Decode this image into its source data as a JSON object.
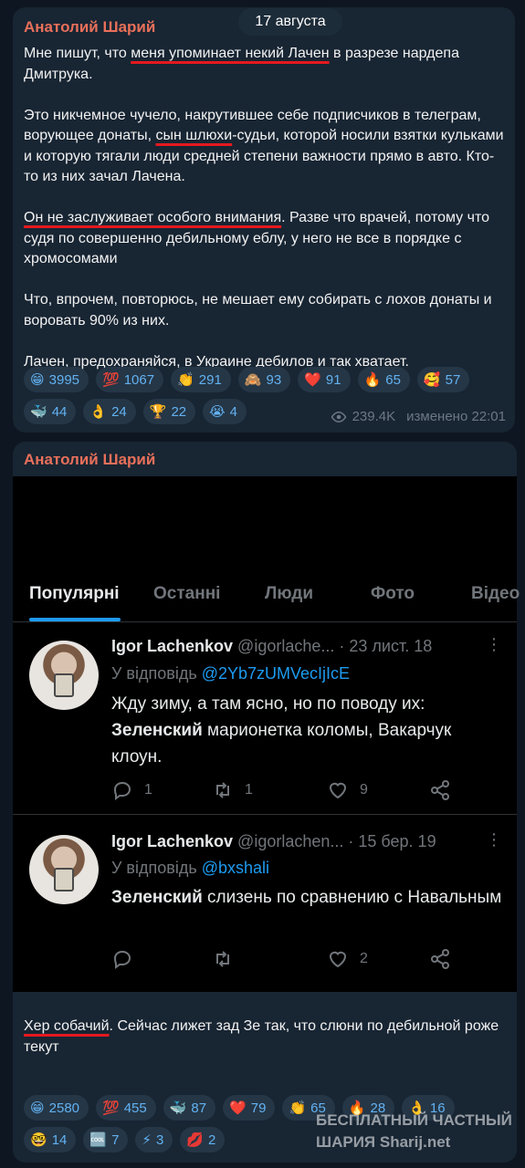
{
  "date_separator": "17 августа",
  "message1": {
    "author": "Анатолий Шарий",
    "paragraphs": [
      [
        "Мне пишут, что ",
        "меня упоминает некий Лачен",
        " в разрезе нардепа Дмитрука."
      ],
      [
        "Это никчемное чучело, накрутившее себе подписчиков в телеграм, ворующее донаты, ",
        "сын шлюхи",
        "-судьи, которой носили взятки кульками и которую тягали люди средней степени важности прямо в авто. Кто-то из них зачал Лачена."
      ],
      [
        "",
        "Он не заслуживает особого внимания",
        ". Разве что врачей, потому что судя по совершенно дебильному еблу, у него не все в порядке с хромосомами"
      ],
      [
        "Что, впрочем, повторюсь, не мешает ему собирать с лохов донаты и воровать 90% из них."
      ],
      [
        "Лачен, предохраняйся, в Украине дебилов и так хватает."
      ]
    ],
    "reactions": [
      {
        "emoji": "😁",
        "count": "3995"
      },
      {
        "emoji": "💯",
        "count": "1067"
      },
      {
        "emoji": "👏",
        "count": "291"
      },
      {
        "emoji": "🙈",
        "count": "93"
      },
      {
        "emoji": "❤️",
        "count": "91"
      },
      {
        "emoji": "🔥",
        "count": "65"
      },
      {
        "emoji": "🥰",
        "count": "57"
      },
      {
        "emoji": "🐳",
        "count": "44"
      },
      {
        "emoji": "👌",
        "count": "24"
      },
      {
        "emoji": "🏆",
        "count": "22"
      },
      {
        "emoji": "😭",
        "count": "4"
      }
    ],
    "views": "239.4K",
    "edited_time": "изменено 22:01"
  },
  "message2": {
    "author": "Анатолий Шарий",
    "screenshot": {
      "tabs": [
        "Популярні",
        "Останні",
        "Люди",
        "Фото",
        "Відео"
      ],
      "tweets": [
        {
          "name": "Igor Lachenkov",
          "handle": "@igorlache...",
          "date": "· 23 лист. 18",
          "reply_prefix": "У відповідь ",
          "reply_handle": "@2Yb7zUMVecIjIcE",
          "body_pre": "Жду зиму, а там ясно, но по поводу их: ",
          "body_bold": "Зеленский",
          "body_post": " марионетка коломы, Вакарчук клоун.",
          "replies": "1",
          "retweets": "1",
          "likes": "9"
        },
        {
          "name": "Igor Lachenkov",
          "handle": "@igorlachen...",
          "date": "· 15 бер. 19",
          "reply_prefix": "У відповідь ",
          "reply_handle": "@bxshali",
          "body_pre": "",
          "body_bold": "Зеленский",
          "body_post": " слизень по сравнению с Навальным",
          "replies": "",
          "retweets": "",
          "likes": "2"
        }
      ]
    },
    "caption_underlined": "Хер собачий",
    "caption_rest": ". Сейчас лижет зад Зе так, что слюни по дебильной роже текут",
    "reactions": [
      {
        "emoji": "😁",
        "count": "2580"
      },
      {
        "emoji": "💯",
        "count": "455"
      },
      {
        "emoji": "🐳",
        "count": "87"
      },
      {
        "emoji": "❤️",
        "count": "79"
      },
      {
        "emoji": "👏",
        "count": "65"
      },
      {
        "emoji": "🔥",
        "count": "28"
      },
      {
        "emoji": "👌",
        "count": "16"
      },
      {
        "emoji": "🤓",
        "count": "14"
      },
      {
        "emoji": "🆒",
        "count": "7"
      },
      {
        "emoji": "⚡",
        "count": "3"
      },
      {
        "emoji": "💋",
        "count": "2"
      }
    ]
  },
  "watermark": {
    "line1": "БЕСПЛАТНЫЙ ЧАСТНЫЙ",
    "line2": "ШАРИЯ Sharij.net"
  }
}
